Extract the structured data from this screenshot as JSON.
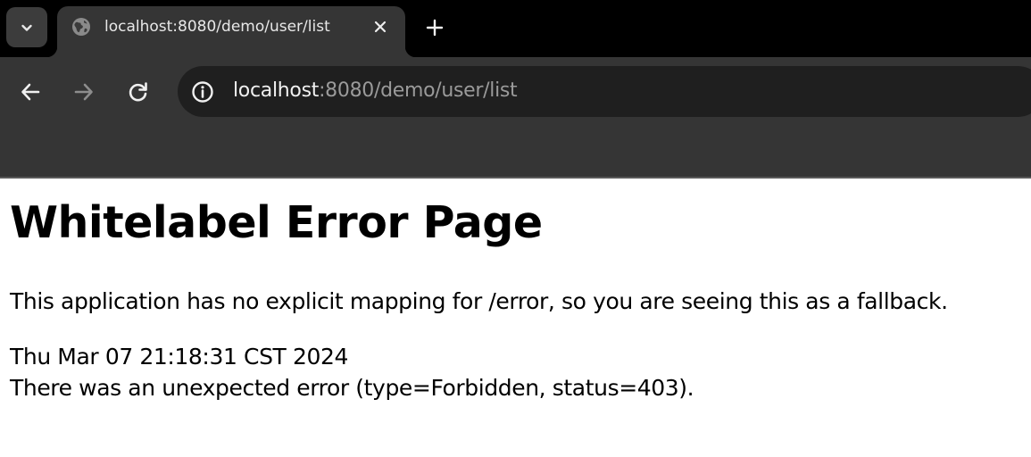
{
  "browser": {
    "tab": {
      "title": "localhost:8080/demo/user/list",
      "favicon": "globe-icon"
    },
    "address_bar": {
      "host": "localhost",
      "path": ":8080/demo/user/list",
      "site_info_icon": "info-icon"
    },
    "icons": {
      "tab_search": "chevron-down-icon",
      "close_tab": "close-icon",
      "new_tab": "plus-icon",
      "back": "arrow-left-icon",
      "forward": "arrow-right-icon",
      "reload": "reload-icon"
    },
    "colors": {
      "tabstrip_bg": "#000000",
      "toolbar_bg": "#353535",
      "omnibox_bg": "#1f1f1f"
    }
  },
  "page": {
    "heading": "Whitelabel Error Page",
    "mapping_message": "This application has no explicit mapping for /error, so you are seeing this as a fallback.",
    "timestamp": "Thu Mar 07 21:18:31 CST 2024",
    "error_message": "There was an unexpected error (type=Forbidden, status=403)."
  }
}
